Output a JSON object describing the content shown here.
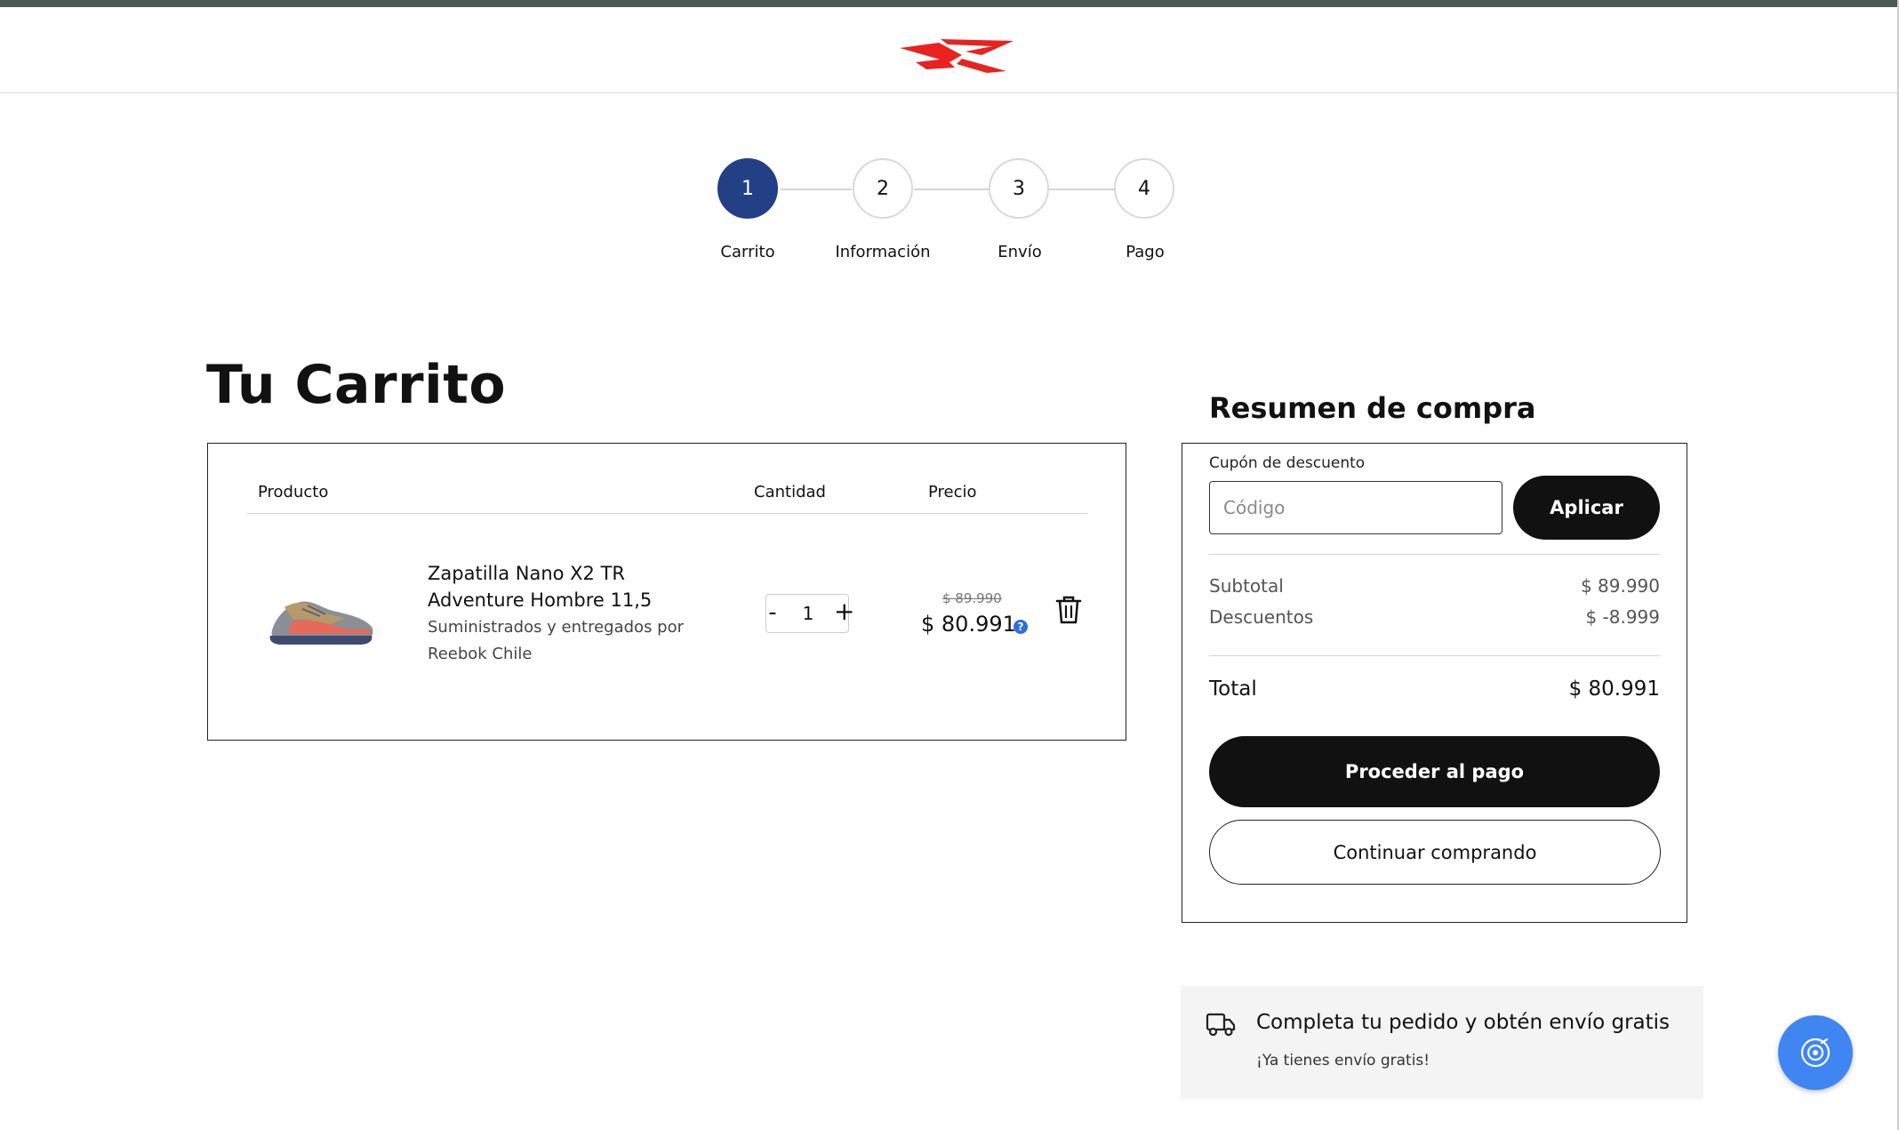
{
  "brand": {
    "logo_icon": "reebok-vector-logo-icon",
    "logo_color": "#e8231f"
  },
  "stepper": {
    "steps": [
      {
        "number": "1",
        "label": "Carrito",
        "active": true
      },
      {
        "number": "2",
        "label": "Información",
        "active": false
      },
      {
        "number": "3",
        "label": "Envío",
        "active": false
      },
      {
        "number": "4",
        "label": "Pago",
        "active": false
      }
    ],
    "active_color": "#233f86"
  },
  "cart": {
    "title": "Tu Carrito",
    "columns": {
      "product": "Producto",
      "quantity": "Cantidad",
      "price": "Precio"
    },
    "items": [
      {
        "image_icon": "shoe-product-image",
        "name": "Zapatilla Nano X2 TR Adventure Hombre 11,5",
        "seller": "Suministrados y entregados por Reebok Chile",
        "quantity_minus": "-",
        "quantity": "1",
        "quantity_plus": "+",
        "original_price": "$ 89.990",
        "price": "$ 80.991",
        "help_icon": "?",
        "delete_icon": "trash-icon"
      }
    ]
  },
  "summary": {
    "title": "Resumen de compra",
    "coupon_label": "Cupón de descuento",
    "coupon_placeholder": "Código",
    "coupon_value": "",
    "apply_label": "Aplicar",
    "subtotal_label": "Subtotal",
    "subtotal_value": "$ 89.990",
    "discount_label": "Descuentos",
    "discount_value": "$ -8.999",
    "total_label": "Total",
    "total_value": "$ 80.991",
    "checkout_label": "Proceder al pago",
    "continue_label": "Continuar comprando"
  },
  "shipping": {
    "icon": "truck-icon",
    "title": "Completa tu pedido y obtén envío gratis",
    "subtitle": "¡Ya tienes envío gratis!"
  },
  "fab": {
    "icon": "target-chat-icon",
    "color": "#3f86f2"
  }
}
